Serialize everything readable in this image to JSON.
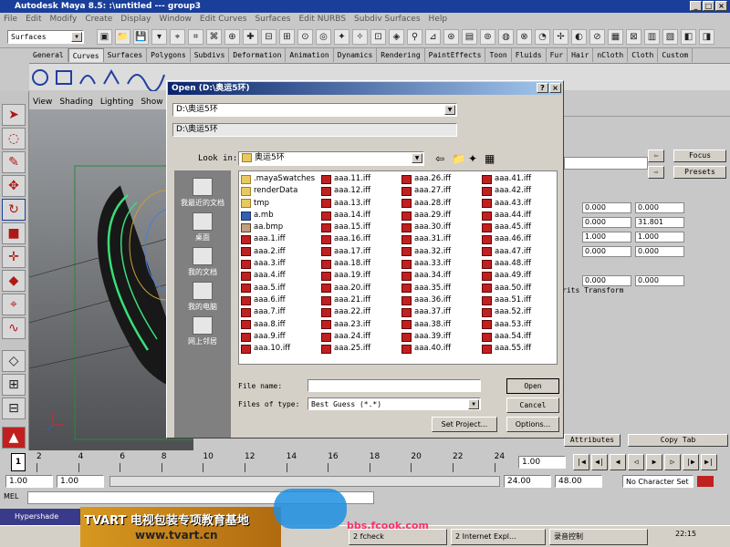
{
  "window": {
    "title": "Autodesk Maya 8.5: :\\untitled   ---   group3"
  },
  "menu": [
    "File",
    "Edit",
    "Modify",
    "Create",
    "Display",
    "Window",
    "Edit Curves",
    "Surfaces",
    "Edit NURBS",
    "Subdiv Surfaces",
    "Help"
  ],
  "toolbar": {
    "mode_value": "Surfaces"
  },
  "shelf_tabs": [
    "General",
    "Curves",
    "Surfaces",
    "Polygons",
    "Subdivs",
    "Deformation",
    "Animation",
    "Dynamics",
    "Rendering",
    "PaintEffects",
    "Toon",
    "Fluids",
    "Fur",
    "Hair",
    "nCloth",
    "Cloth",
    "Custom"
  ],
  "shelf_active": "Curves",
  "viewport_menu": [
    "View",
    "Shading",
    "Lighting",
    "Show",
    "Rend"
  ],
  "attr": {
    "focus": "Focus",
    "presets": "Presets",
    "rows": [
      [
        "0.000",
        "0.000"
      ],
      [
        "0.000",
        "31.801"
      ],
      [
        "1.000",
        "1.000"
      ],
      [
        "0.000",
        "0.000"
      ]
    ],
    "row5": [
      "0.000",
      "0.000"
    ],
    "transform_label": "rits Transform",
    "attributes_btn": "Attributes",
    "copy_tab": "Copy Tab"
  },
  "dialog": {
    "title": "Open (D:\\奥运5环)",
    "path1": "D:\\奥运5环",
    "path2": "D:\\奥运5环",
    "look_in_label": "Look in:",
    "look_in_value": "奥运5环",
    "places": [
      "我最近的文档",
      "桌面",
      "我的文档",
      "我的电脑",
      "网上邻居"
    ],
    "columns": [
      [
        ".mayaSwatches",
        "renderData",
        "tmp",
        "a.mb",
        "aa.bmp",
        "aaa.1.iff",
        "aaa.2.iff",
        "aaa.3.iff",
        "aaa.4.iff",
        "aaa.5.iff",
        "aaa.6.iff",
        "aaa.7.iff",
        "aaa.8.iff",
        "aaa.9.iff",
        "aaa.10.iff"
      ],
      [
        "aaa.11.iff",
        "aaa.12.iff",
        "aaa.13.iff",
        "aaa.14.iff",
        "aaa.15.iff",
        "aaa.16.iff",
        "aaa.17.iff",
        "aaa.18.iff",
        "aaa.19.iff",
        "aaa.20.iff",
        "aaa.21.iff",
        "aaa.22.iff",
        "aaa.23.iff",
        "aaa.24.iff",
        "aaa.25.iff"
      ],
      [
        "aaa.26.iff",
        "aaa.27.iff",
        "aaa.28.iff",
        "aaa.29.iff",
        "aaa.30.iff",
        "aaa.31.iff",
        "aaa.32.iff",
        "aaa.33.iff",
        "aaa.34.iff",
        "aaa.35.iff",
        "aaa.36.iff",
        "aaa.37.iff",
        "aaa.38.iff",
        "aaa.39.iff",
        "aaa.40.iff"
      ],
      [
        "aaa.41.iff",
        "aaa.42.iff",
        "aaa.43.iff",
        "aaa.44.iff",
        "aaa.45.iff",
        "aaa.46.iff",
        "aaa.47.iff",
        "aaa.48.iff",
        "aaa.49.iff",
        "aaa.50.iff",
        "aaa.51.iff",
        "aaa.52.iff",
        "aaa.53.iff",
        "aaa.54.iff",
        "aaa.55.iff"
      ]
    ],
    "file_name_label": "File name:",
    "file_name_value": "",
    "files_of_type_label": "Files of type:",
    "files_of_type_value": "Best Guess (*.*)",
    "open": "Open",
    "cancel": "Cancel",
    "set_project": "Set Project...",
    "options": "Options..."
  },
  "timeline": {
    "ticks": [
      "2",
      "4",
      "6",
      "8",
      "10",
      "12",
      "14",
      "16",
      "18",
      "20",
      "22",
      "24"
    ],
    "current": "1",
    "frame_field": "1.00"
  },
  "range": {
    "start": "1.00",
    "start2": "1.00",
    "end": "24.00",
    "end2": "48.00",
    "character": "No Character Set"
  },
  "cmd": {
    "mel": "MEL"
  },
  "hypershade": "Hypershade",
  "banner": {
    "line1": "TVART 电视包装专项教育基地",
    "line2": "www.tvart.cn"
  },
  "watermark": "bbs.fcook.com",
  "taskbar": {
    "fcheck": "2 fcheck",
    "ie": "2 Internet Expl...",
    "volume": "录音控制",
    "clock": "22:15"
  }
}
